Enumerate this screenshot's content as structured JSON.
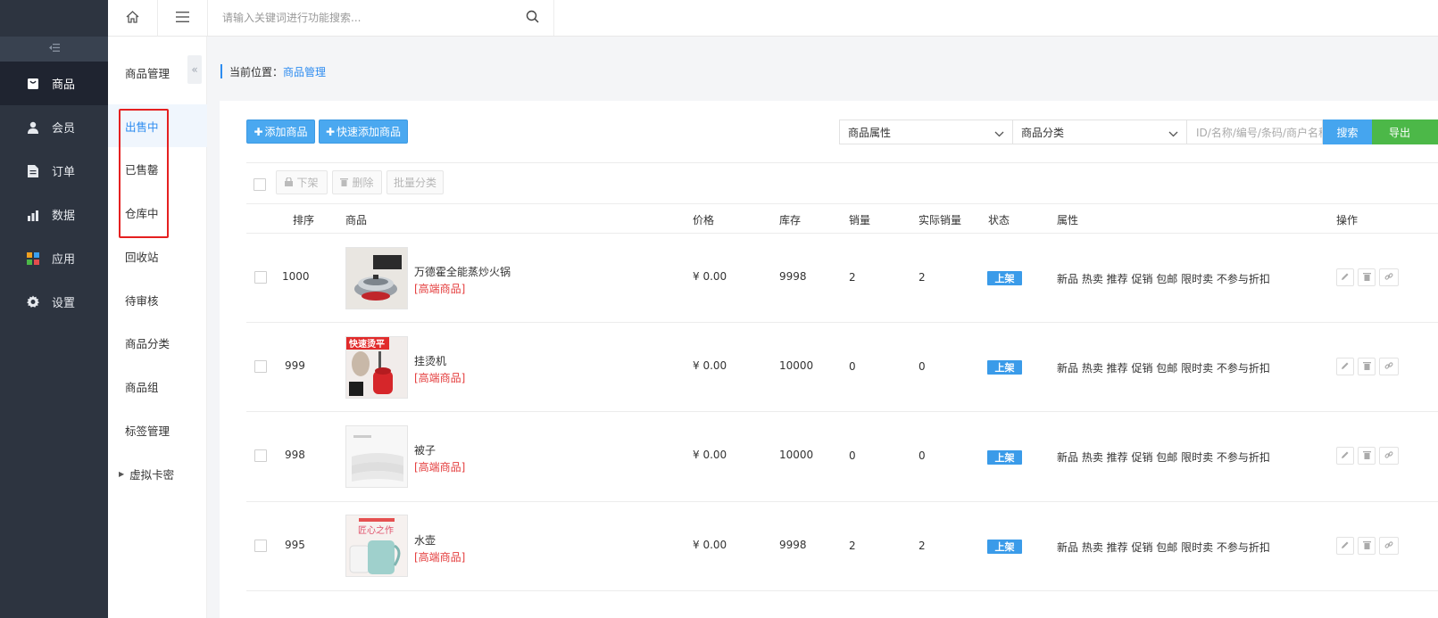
{
  "sidebar": {
    "items": [
      {
        "label": "商品",
        "icon": "bag-icon",
        "active": true
      },
      {
        "label": "会员",
        "icon": "user-icon"
      },
      {
        "label": "订单",
        "icon": "document-icon"
      },
      {
        "label": "数据",
        "icon": "bar-chart-icon"
      },
      {
        "label": "应用",
        "icon": "apps-grid-icon"
      },
      {
        "label": "设置",
        "icon": "gear-icon"
      }
    ]
  },
  "header": {
    "search_placeholder": "请输入关键词进行功能搜索..."
  },
  "submenu": {
    "title": "商品管理",
    "items": [
      {
        "label": "出售中",
        "active": true
      },
      {
        "label": "已售罄"
      },
      {
        "label": "仓库中"
      },
      {
        "label": "回收站"
      },
      {
        "label": "待审核"
      },
      {
        "label": "商品分类"
      },
      {
        "label": "商品组"
      },
      {
        "label": "标签管理"
      },
      {
        "label": "虚拟卡密"
      }
    ]
  },
  "breadcrumb": {
    "prefix": "当前位置：",
    "current": "商品管理"
  },
  "toolbar": {
    "add_label": "添加商品",
    "quick_add_label": "快速添加商品",
    "attr_select": "商品属性",
    "category_select": "商品分类",
    "id_placeholder": "ID/名称/编号/条码/商户名称",
    "search_label": "搜索",
    "export_label": "导出"
  },
  "batch": {
    "offshelf_label": "下架",
    "delete_label": "删除",
    "batch_category_label": "批量分类"
  },
  "table": {
    "headers": {
      "sort": "排序",
      "product": "商品",
      "price": "价格",
      "stock": "库存",
      "sales": "销量",
      "actual_sales": "实际销量",
      "status": "状态",
      "attrs": "属性",
      "ops": "操作"
    },
    "rows": [
      {
        "sort": "1000",
        "name": "万德霍全能蒸炒火锅",
        "label": "[高端商品]",
        "price": "¥ 0.00",
        "stock": "9998",
        "sales": "2",
        "actual": "2",
        "status": "上架",
        "attrs": "新品 热卖 推荐 促销 包邮 限时卖 不参与折扣"
      },
      {
        "sort": "999",
        "name": "挂烫机",
        "label": "[高端商品]",
        "price": "¥ 0.00",
        "stock": "10000",
        "sales": "0",
        "actual": "0",
        "status": "上架",
        "attrs": "新品 热卖 推荐 促销 包邮 限时卖 不参与折扣",
        "thumb_text": "快速烫平"
      },
      {
        "sort": "998",
        "name": "被子",
        "label": "[高端商品]",
        "price": "¥ 0.00",
        "stock": "10000",
        "sales": "0",
        "actual": "0",
        "status": "上架",
        "attrs": "新品 热卖 推荐 促销 包邮 限时卖 不参与折扣"
      },
      {
        "sort": "995",
        "name": "水壶",
        "label": "[高端商品]",
        "price": "¥ 0.00",
        "stock": "9998",
        "sales": "2",
        "actual": "2",
        "status": "上架",
        "attrs": "新品 热卖 推荐 促销 包邮 限时卖 不参与折扣",
        "thumb_text": "匠心之作"
      }
    ]
  },
  "colors": {
    "sidebar_bg": "#2d3440",
    "accent_blue": "#2d8cf0",
    "export_green": "#4cb848",
    "label_red": "#e43d3d"
  }
}
